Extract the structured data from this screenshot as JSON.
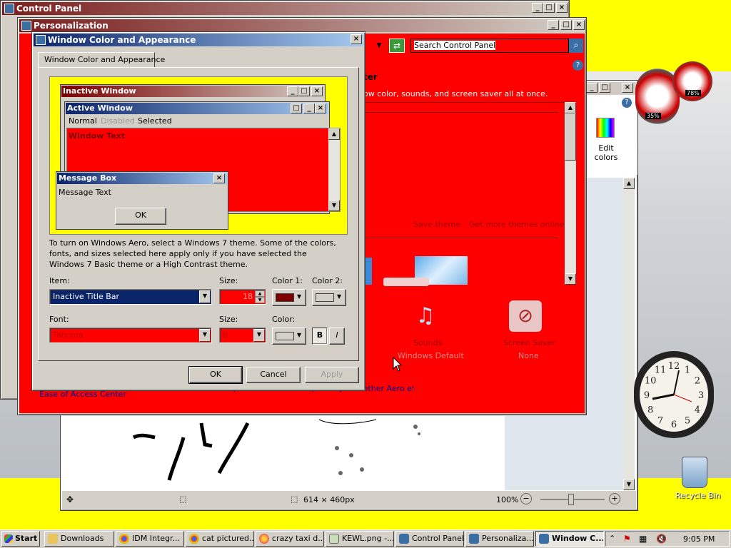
{
  "control_panel": {
    "title": "Control Panel"
  },
  "personalization": {
    "title": "Personalization",
    "search_placeholder": "Search Control Panel",
    "heading_partial": "ter",
    "desc_partial": "ow color, sounds, and screen saver all at once.",
    "save_theme": "Save theme",
    "get_more_themes": "Get more themes online",
    "sounds_label": "Sounds",
    "sounds_value": "Windows Default",
    "screensaver_label": "Screen Saver",
    "screensaver_value": "None",
    "ease_access": "Ease of Access Center",
    "aero_link": "Troubleshoot problems with transparency and other Aero effects"
  },
  "paint": {
    "edit_colors": "Edit colors",
    "dimensions": "614 × 460px",
    "zoom": "100%"
  },
  "gadgets": {
    "cpu": "35%",
    "mem": "78%"
  },
  "desktop": {
    "recycle_bin": "Recycle Bin"
  },
  "dialog": {
    "title": "Window Color and Appearance",
    "tab": "Window Color and Appearance",
    "preview": {
      "inactive_title": "Inactive Window",
      "active_title": "Active Window",
      "menu": [
        "Normal",
        "Disabled",
        "Selected"
      ],
      "window_text": "Window Text",
      "msgbox_title": "Message Box",
      "msgbox_text": "Message Text",
      "ok": "OK"
    },
    "info": "To turn on Windows Aero, select a Windows 7 theme.  Some of the colors, fonts, and sizes selected here apply only if you have selected the Windows 7 Basic theme or a High Contrast theme.",
    "item_label": "Item:",
    "item_value": "Inactive Title Bar",
    "size_label": "Size:",
    "size_value": "18",
    "color1_label": "Color 1:",
    "color2_label": "Color 2:",
    "font_label": "Font:",
    "font_value": "Tahoma",
    "font_size_label": "Size:",
    "font_size_value": "8",
    "color_label": "Color:",
    "bold": "B",
    "italic": "I",
    "ok": "OK",
    "cancel": "Cancel",
    "apply": "Apply",
    "color1_hex": "#7b0000",
    "color2_hex": "#d4d0c8"
  },
  "taskbar": {
    "start": "Start",
    "items": [
      "Downloads",
      "IDM Integr...",
      "cat pictured...",
      "crazy taxi d...",
      "KEWL.png -...",
      "Control Panel",
      "Personaliza...",
      "Window C..."
    ],
    "clock": "9:05 PM"
  },
  "clock_gadget": {
    "numbers": [
      "12",
      "1",
      "2",
      "3",
      "4",
      "5",
      "6",
      "7",
      "8",
      "9",
      "10",
      "11"
    ]
  }
}
